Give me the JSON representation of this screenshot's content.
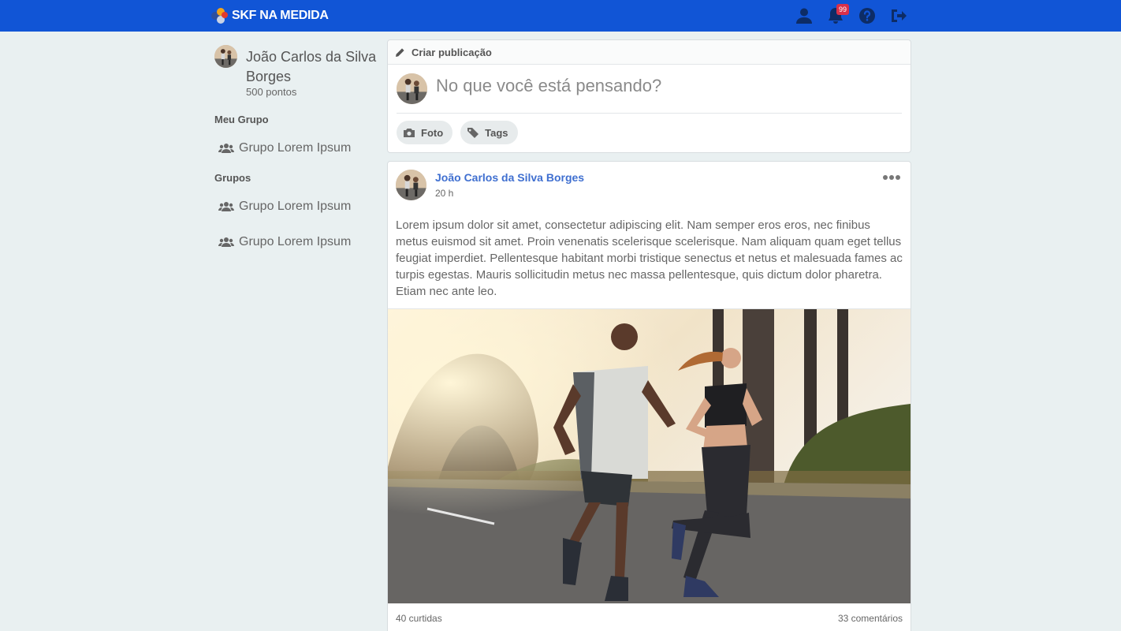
{
  "header": {
    "logo_text": "SKF NA MEDIDA",
    "notifications_count": "99",
    "icons": [
      "user-icon",
      "bell-icon",
      "help-icon",
      "logout-icon"
    ],
    "brand_color": "#1155d6"
  },
  "sidebar": {
    "user_name": "João Carlos da Silva Borges",
    "points": "500 pontos",
    "my_group_heading": "Meu Grupo",
    "my_group": "Grupo Lorem Ipsum",
    "groups_heading": "Grupos",
    "groups": [
      "Grupo Lorem Ipsum",
      "Grupo Lorem Ipsum"
    ]
  },
  "create_post": {
    "title": "Criar publicação",
    "placeholder": "No que você está pensando?",
    "photo_label": "Foto",
    "tags_label": "Tags"
  },
  "post": {
    "author": "João Carlos da Silva Borges",
    "time": "20 h",
    "text": "Lorem ipsum dolor sit amet, consectetur adipiscing elit. Nam semper eros eros, nec finibus metus euismod sit amet. Proin venenatis scelerisque scelerisque. Nam aliquam quam eget tellus feugiat imperdiet. Pellentesque habitant morbi tristique senectus et netus et malesuada fames ac turpis egestas. Mauris sollicitudin metus nec massa pellentesque, quis dictum dolor pharetra. Etiam nec ante leo.",
    "likes": "40 curtidas",
    "comments": "33 comentários"
  }
}
